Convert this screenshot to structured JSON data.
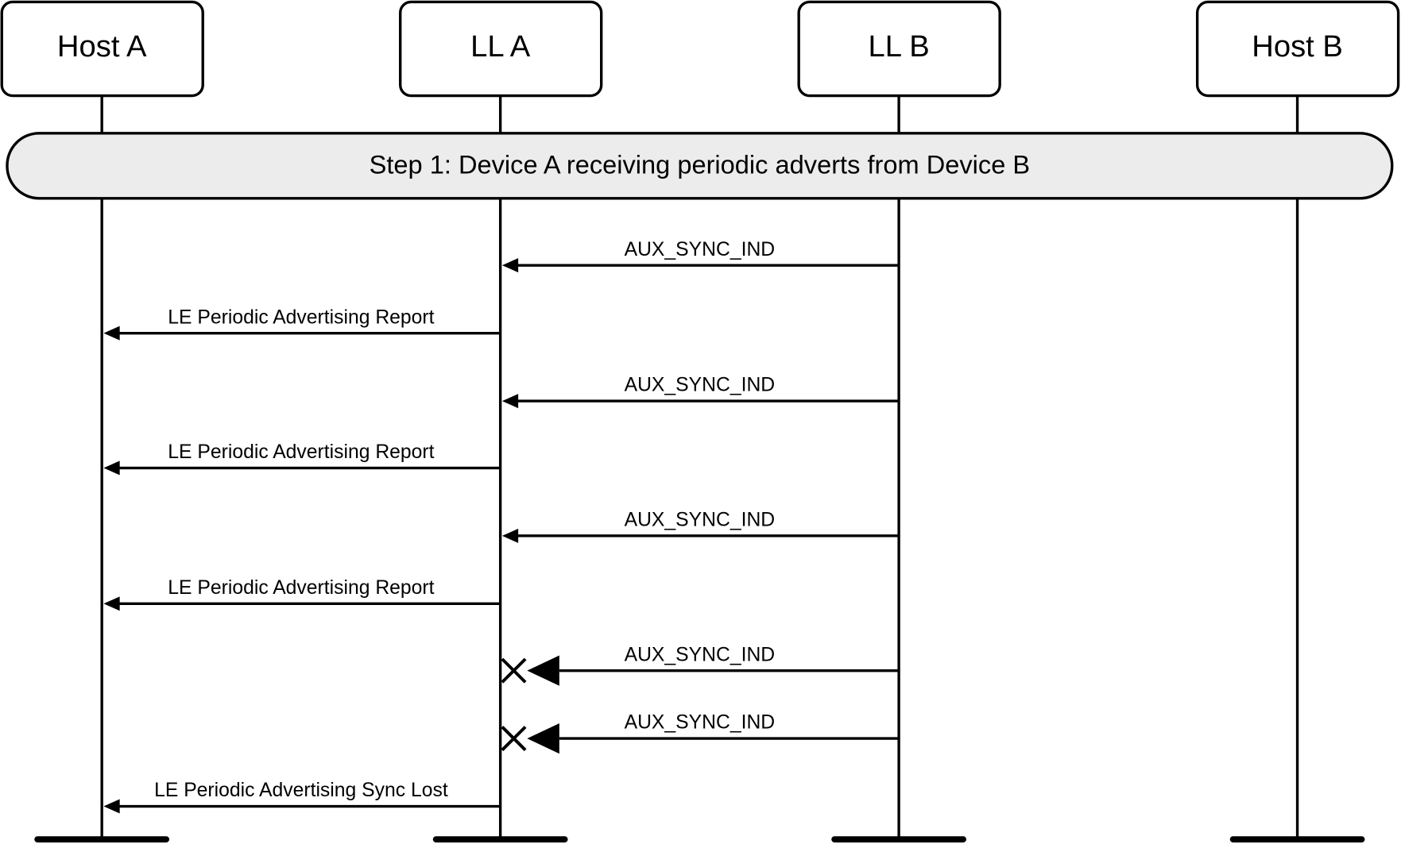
{
  "participants": [
    {
      "id": "host-a",
      "label": "Host A"
    },
    {
      "id": "ll-a",
      "label": "LL A"
    },
    {
      "id": "ll-b",
      "label": "LL B"
    },
    {
      "id": "host-b",
      "label": "Host B"
    }
  ],
  "step": {
    "label": "Step 1:  Device A receiving periodic adverts from Device B"
  },
  "messages": [
    {
      "from": 2,
      "to": 1,
      "label": "AUX_SYNC_IND",
      "lost": false
    },
    {
      "from": 1,
      "to": 0,
      "label": "LE Periodic Advertising Report",
      "lost": false
    },
    {
      "from": 2,
      "to": 1,
      "label": "AUX_SYNC_IND",
      "lost": false
    },
    {
      "from": 1,
      "to": 0,
      "label": "LE Periodic Advertising Report",
      "lost": false
    },
    {
      "from": 2,
      "to": 1,
      "label": "AUX_SYNC_IND",
      "lost": false
    },
    {
      "from": 1,
      "to": 0,
      "label": "LE Periodic Advertising Report",
      "lost": false
    },
    {
      "from": 2,
      "to": 1,
      "label": "AUX_SYNC_IND",
      "lost": true
    },
    {
      "from": 2,
      "to": 1,
      "label": "AUX_SYNC_IND",
      "lost": true
    },
    {
      "from": 1,
      "to": 0,
      "label": "LE Periodic Advertising Sync Lost",
      "lost": false
    }
  ],
  "colors": {
    "line": "#000000",
    "step_fill": "#ececec"
  }
}
